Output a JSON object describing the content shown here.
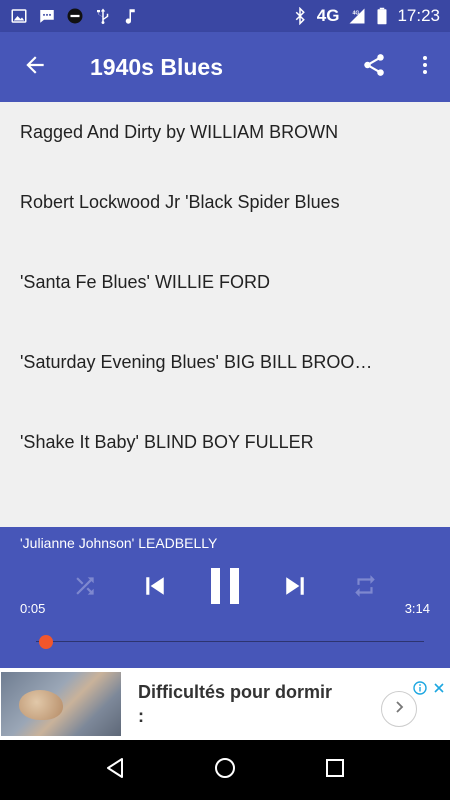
{
  "status_bar": {
    "network": "4G",
    "network_small": "4G",
    "time": "17:23",
    "left_icons": [
      "image-icon",
      "message-icon",
      "app-badge-icon",
      "usb-icon",
      "music-note-icon"
    ],
    "right_icons": [
      "bluetooth-icon",
      "signal-icon",
      "battery-icon"
    ]
  },
  "app_bar": {
    "title": "1940s Blues",
    "icons": [
      "back-arrow-icon",
      "share-icon",
      "more-vert-icon"
    ]
  },
  "tracks": [
    "Ragged And Dirty by WILLIAM BROWN",
    "Robert Lockwood Jr 'Black Spider Blues",
    "'Santa Fe Blues' WILLIE FORD",
    "'Saturday Evening Blues' BIG BILL BROO…",
    "'Shake It Baby' BLIND BOY FULLER"
  ],
  "player": {
    "now_playing": "'Julianne Johnson' LEADBELLY",
    "elapsed": "0:05",
    "duration": "3:14",
    "progress_fraction": 0.026,
    "state": "playing",
    "icons": [
      "shuffle-icon",
      "skip-previous-icon",
      "pause-icon",
      "skip-next-icon",
      "repeat-icon"
    ],
    "accent_color": "#f2562c"
  },
  "ad": {
    "text": "Difficultés pour dormir :",
    "icons": [
      "ad-info-icon",
      "ad-close-icon",
      "chevron-right-icon"
    ]
  },
  "nav_bar": {
    "icons": [
      "back-triangle-icon",
      "home-circle-icon",
      "recents-square-icon"
    ]
  },
  "colors": {
    "primary": "#4756b8",
    "status_bar": "#3a47a3",
    "background": "#f0f0f0"
  }
}
